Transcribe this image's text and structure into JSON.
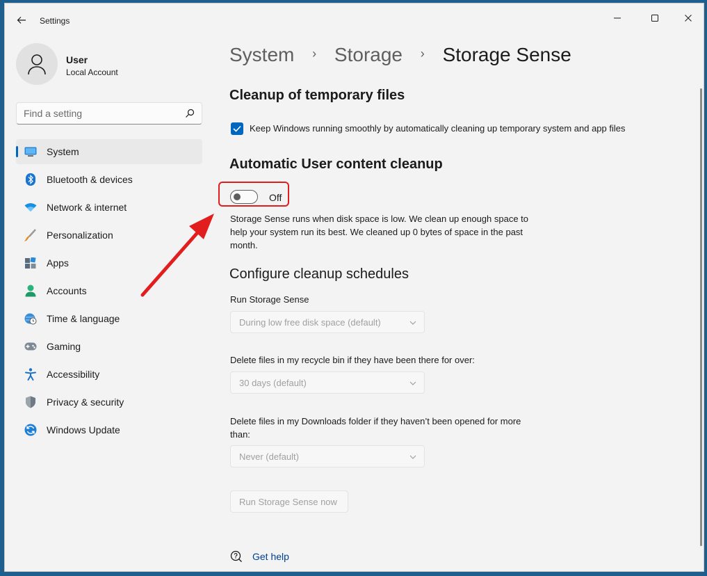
{
  "window": {
    "title": "Settings"
  },
  "user": {
    "name": "User",
    "account_type": "Local Account"
  },
  "search": {
    "placeholder": "Find a setting"
  },
  "sidebar": {
    "items": [
      {
        "label": "System",
        "icon": "system-icon",
        "active": true
      },
      {
        "label": "Bluetooth & devices",
        "icon": "bluetooth-icon"
      },
      {
        "label": "Network & internet",
        "icon": "wifi-icon"
      },
      {
        "label": "Personalization",
        "icon": "brush-icon"
      },
      {
        "label": "Apps",
        "icon": "apps-icon"
      },
      {
        "label": "Accounts",
        "icon": "accounts-icon"
      },
      {
        "label": "Time & language",
        "icon": "globe-clock-icon"
      },
      {
        "label": "Gaming",
        "icon": "gamepad-icon"
      },
      {
        "label": "Accessibility",
        "icon": "accessibility-icon"
      },
      {
        "label": "Privacy & security",
        "icon": "shield-icon"
      },
      {
        "label": "Windows Update",
        "icon": "update-icon"
      }
    ]
  },
  "breadcrumb": {
    "items": [
      "System",
      "Storage",
      "Storage Sense"
    ]
  },
  "cleanup_temp": {
    "heading": "Cleanup of temporary files",
    "checkbox_label": "Keep Windows running smoothly by automatically cleaning up temporary system and app files",
    "checked": true
  },
  "auto_cleanup": {
    "heading": "Automatic User content cleanup",
    "toggle_state": "Off",
    "description": "Storage Sense runs when disk space is low. We clean up enough space to help your system run its best. We cleaned up 0 bytes of space in the past month."
  },
  "schedules": {
    "heading": "Configure cleanup schedules",
    "run_label": "Run Storage Sense",
    "run_value": "During low free disk space (default)",
    "recycle_label": "Delete files in my recycle bin if they have been there for over:",
    "recycle_value": "30 days (default)",
    "downloads_label": "Delete files in my Downloads folder if they haven’t been opened for more than:",
    "downloads_value": "Never (default)",
    "run_now_button": "Run Storage Sense now"
  },
  "help": {
    "label": "Get help"
  },
  "colors": {
    "accent": "#0067c0",
    "highlight_red": "#e21d1d"
  }
}
